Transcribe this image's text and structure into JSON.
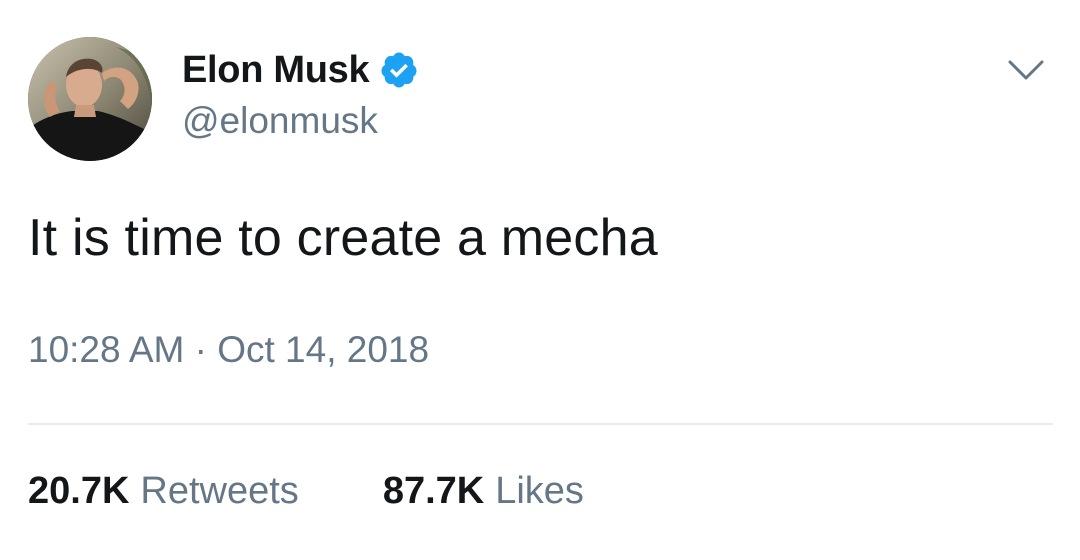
{
  "author": {
    "display_name": "Elon Musk",
    "handle": "@elonmusk",
    "verified": true,
    "avatar_icon": "profile-photo"
  },
  "menu_icon": "chevron-down-icon",
  "tweet": {
    "text": "It is time to create a mecha",
    "timestamp": "10:28 AM · Oct 14, 2018"
  },
  "stats": {
    "retweets_count": "20.7K",
    "retweets_label": "Retweets",
    "likes_count": "87.7K",
    "likes_label": "Likes"
  },
  "colors": {
    "primary_text": "#14171a",
    "secondary_text": "#657786",
    "verified_blue": "#1da1f2",
    "divider": "#e6ecf0"
  }
}
